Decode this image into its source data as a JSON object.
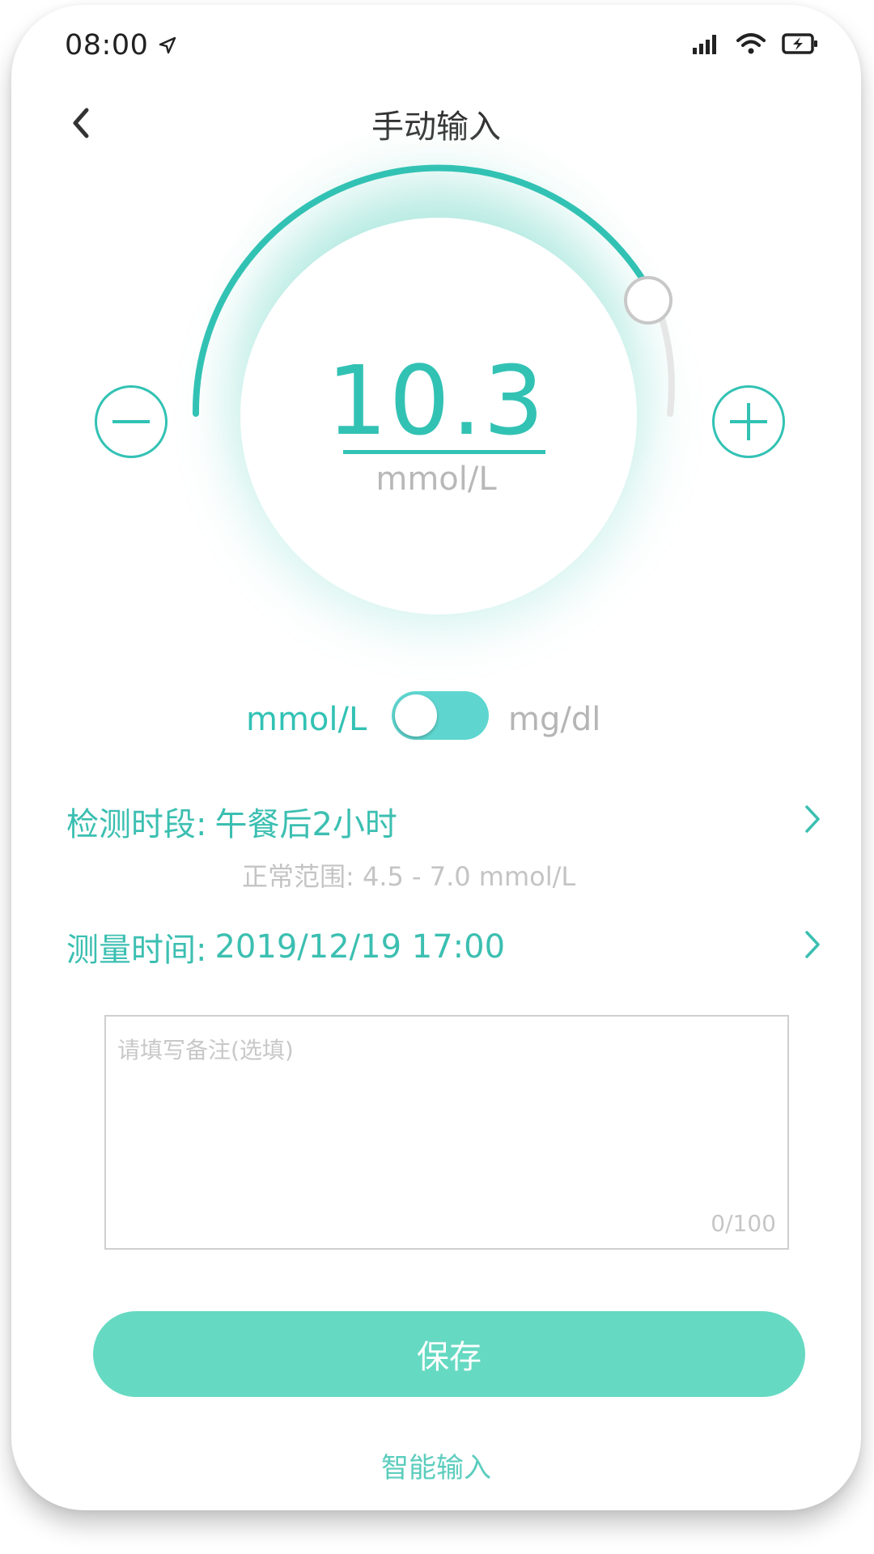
{
  "status_bar": {
    "time": "08:00"
  },
  "header": {
    "title": "手动输入"
  },
  "gauge": {
    "value": "10.3",
    "unit": "mmol/L",
    "level": 0.75
  },
  "unit_toggle": {
    "left_label": "mmol/L",
    "right_label": "mg/dl",
    "selected": "mmol/L"
  },
  "period": {
    "label": "检测时段:",
    "value": "午餐后2小时",
    "normal_range": "正常范围: 4.5 - 7.0 mmol/L"
  },
  "measure_time": {
    "label": "测量时间:",
    "value": "2019/12/19  17:00"
  },
  "note": {
    "placeholder": "请填写备注(选填)",
    "counter": "0/100"
  },
  "actions": {
    "save_label": "保存",
    "smart_input_label": "智能输入"
  },
  "colors": {
    "accent": "#32c2b4",
    "button": "#66d9c2",
    "toggle": "#5ed6cf"
  }
}
